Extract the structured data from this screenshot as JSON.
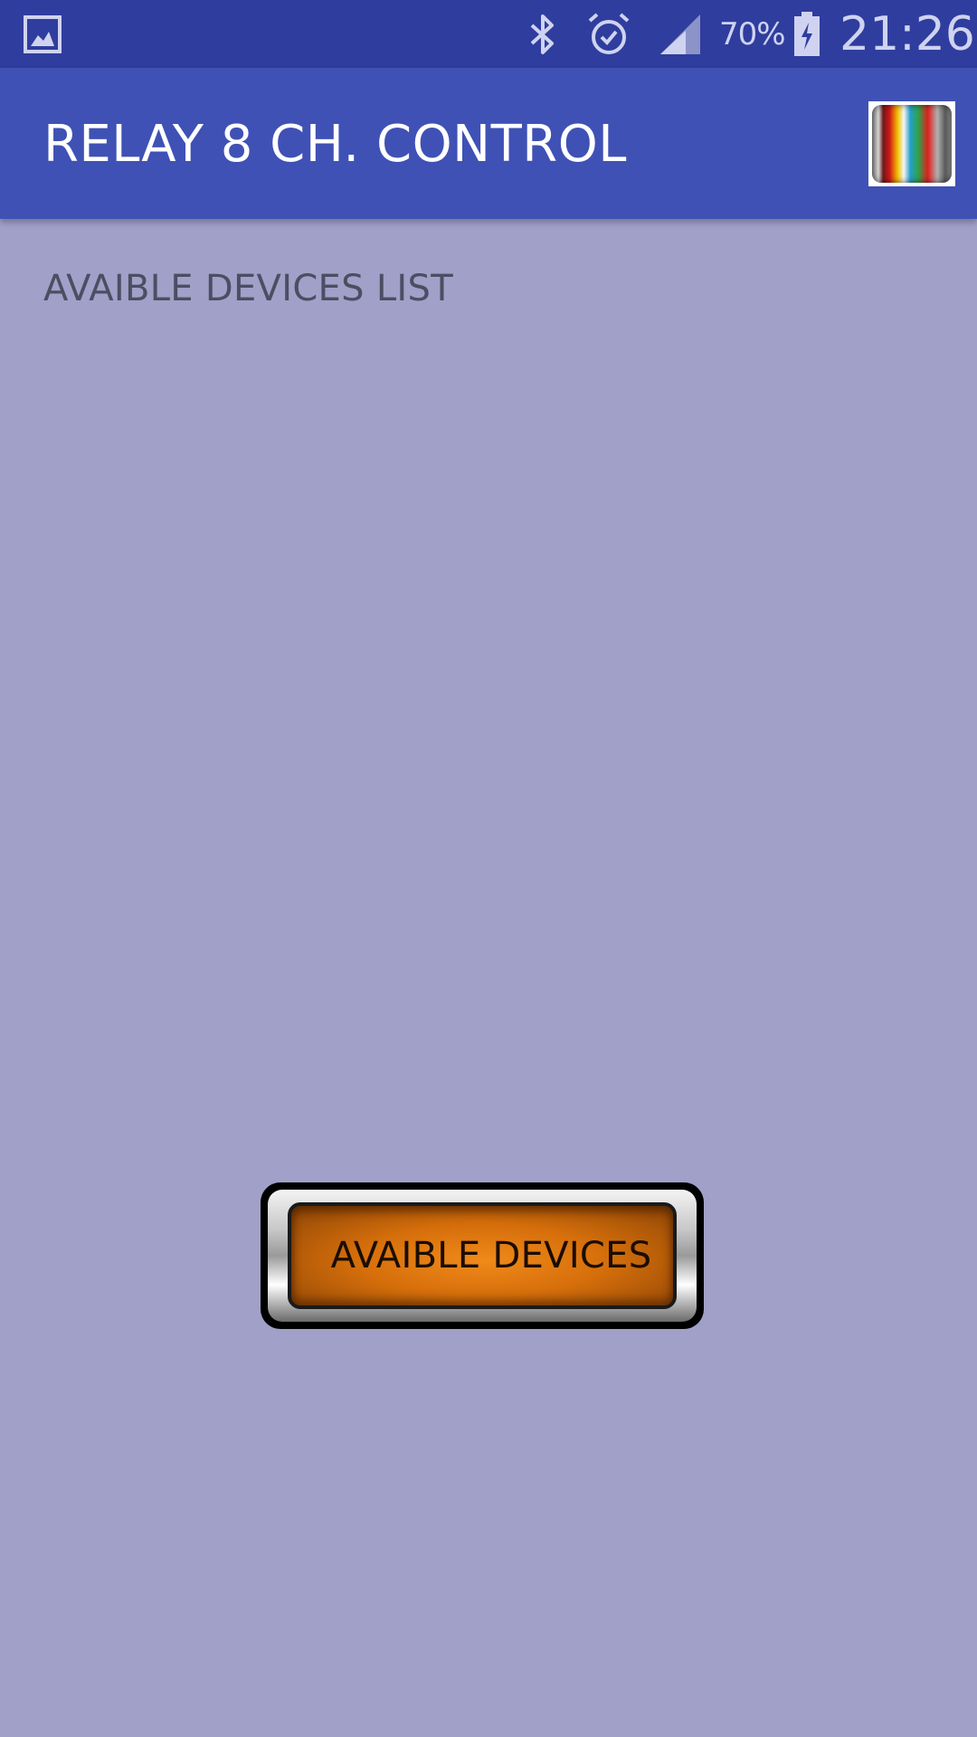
{
  "status_bar": {
    "battery_percent": "70%",
    "time": "21:26",
    "icons": [
      "gallery-icon",
      "bluetooth-icon",
      "alarm-icon",
      "signal-icon",
      "battery-charging-icon"
    ]
  },
  "app_bar": {
    "title": "RELAY 8 CH. CONTROL",
    "logo_icon": "rainbow-stripes-logo"
  },
  "main": {
    "list_heading": "AVAIBLE DEVICES LIST",
    "devices": [],
    "button_label": "AVAIBLE DEVICES"
  },
  "colors": {
    "status_bar": "#2f3d9e",
    "app_bar": "#3f51b5",
    "background": "#a0a0c8",
    "button_face": "#e07a10"
  }
}
